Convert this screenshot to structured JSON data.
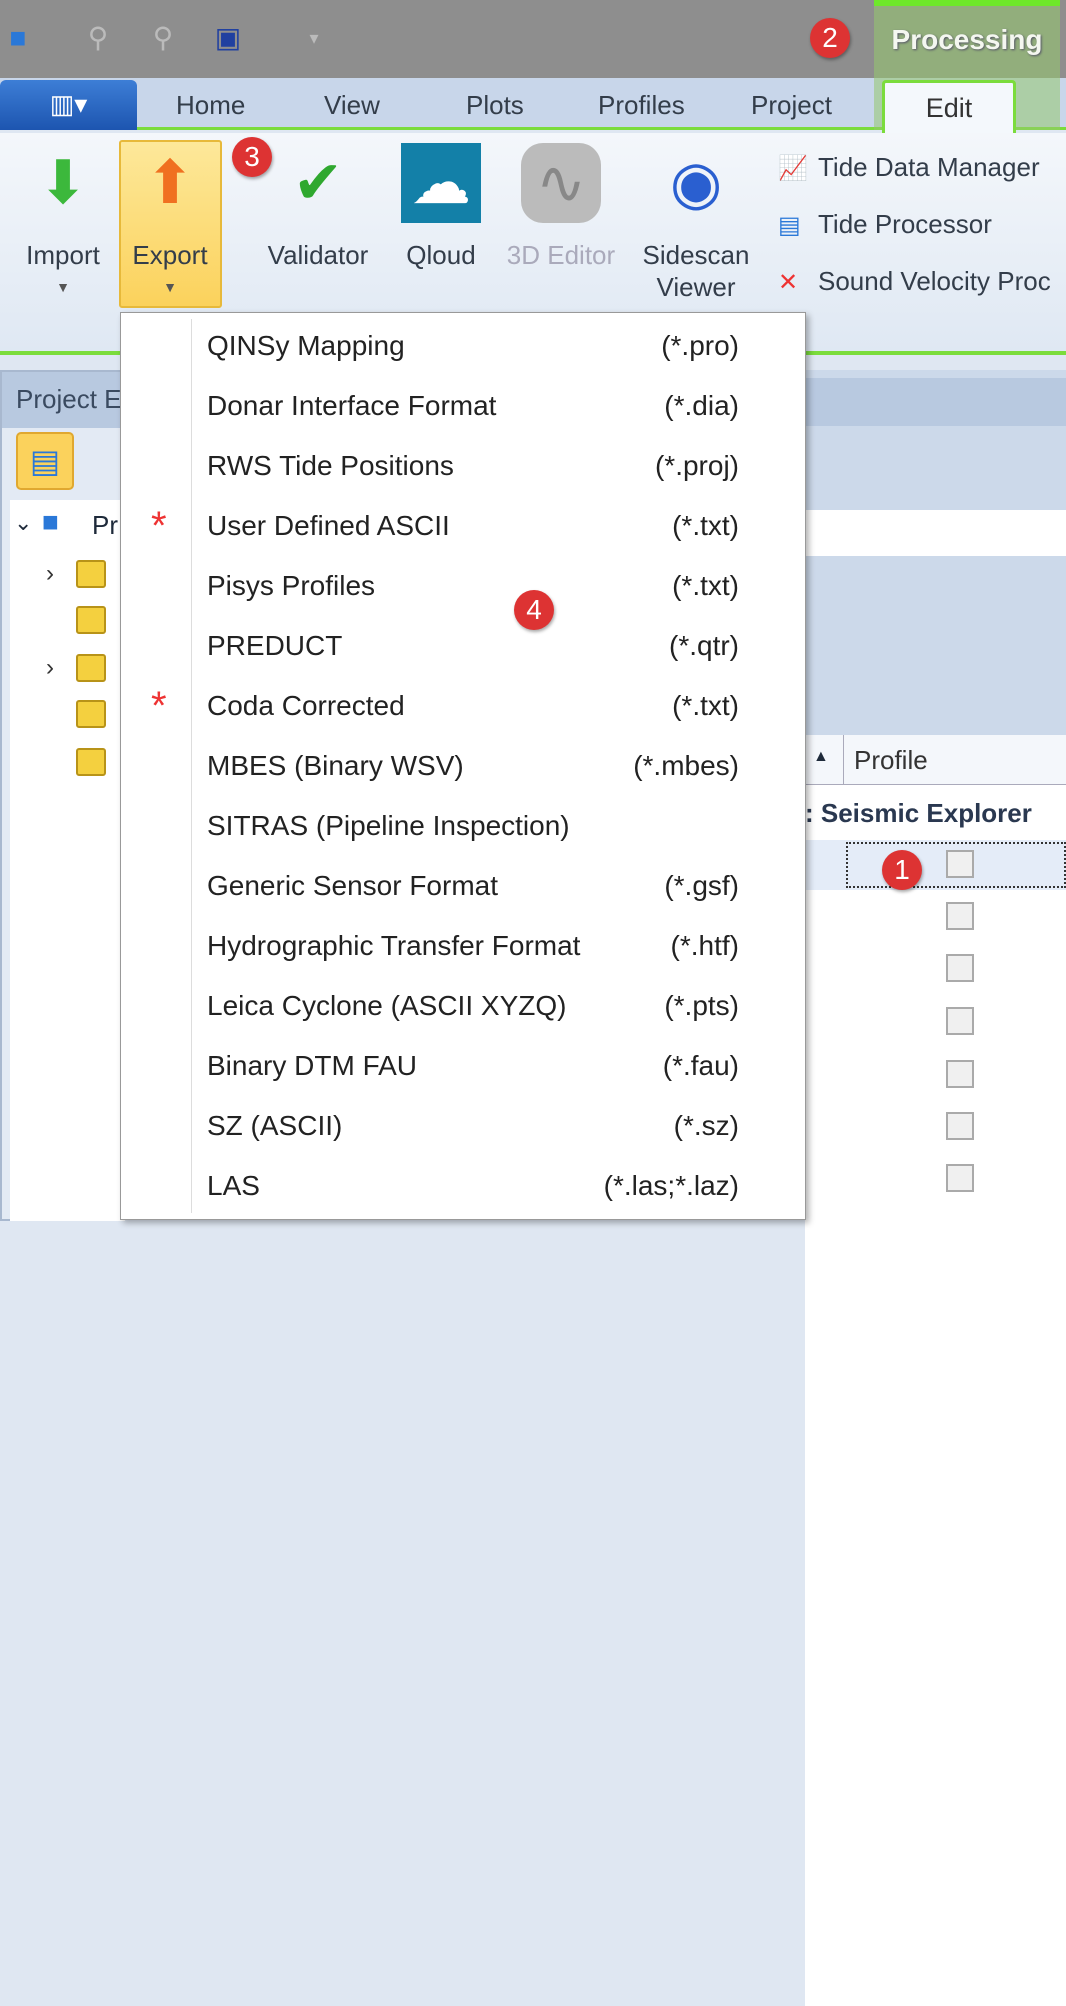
{
  "titlebar": {
    "context_tab": "Processing"
  },
  "tabs": [
    "Home",
    "View",
    "Plots",
    "Profiles",
    "Project",
    "Edit"
  ],
  "ribbon": {
    "buttons": [
      {
        "label": "Import",
        "dropdown": true
      },
      {
        "label": "Export",
        "dropdown": true
      },
      {
        "label": "Validator"
      },
      {
        "label": "Qloud"
      },
      {
        "label": "3D Editor",
        "disabled": true
      },
      {
        "label": "Sidescan\nViewer"
      }
    ],
    "small_buttons": [
      "Tide Data Manager",
      "Tide Processor",
      "Sound Velocity Proc"
    ]
  },
  "badges": [
    "1",
    "2",
    "3",
    "4"
  ],
  "project_explorer": {
    "title": "Project E",
    "root": "Pr"
  },
  "grid": {
    "sort_indicator": "▲",
    "column": "Profile",
    "group": ": Seismic Explorer"
  },
  "export_menu": [
    {
      "label": "QINSy Mapping",
      "ext": "(*.pro)"
    },
    {
      "label": "Donar Interface Format",
      "ext": "(*.dia)"
    },
    {
      "label": "RWS Tide Positions",
      "ext": "(*.proj)"
    },
    {
      "label": "User Defined ASCII",
      "ext": "(*.txt)",
      "starred": true
    },
    {
      "label": "Pisys Profiles",
      "ext": "(*.txt)"
    },
    {
      "label": "PREDUCT",
      "ext": "(*.qtr)"
    },
    {
      "label": "Coda Corrected",
      "ext": "(*.txt)",
      "starred": true
    },
    {
      "label": "MBES (Binary WSV)",
      "ext": "(*.mbes)"
    },
    {
      "label": "SITRAS (Pipeline Inspection)",
      "ext": ""
    },
    {
      "label": "Generic Sensor Format",
      "ext": "(*.gsf)"
    },
    {
      "label": "Hydrographic Transfer Format",
      "ext": "(*.htf)"
    },
    {
      "label": "Leica Cyclone (ASCII XYZQ)",
      "ext": "(*.pts)"
    },
    {
      "label": "Binary DTM FAU",
      "ext": "(*.fau)"
    },
    {
      "label": "SZ (ASCII)",
      "ext": "(*.sz)"
    },
    {
      "label": "LAS",
      "ext": "(*.las;*.laz)"
    }
  ],
  "colors": {
    "accent_green": "#7bdc3c",
    "badge_red": "#dd3333",
    "export_highlight": "#fbd25c"
  }
}
